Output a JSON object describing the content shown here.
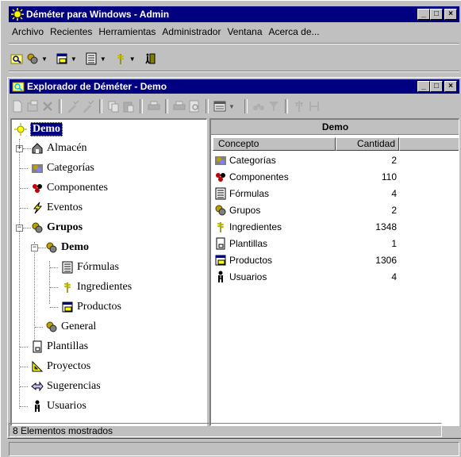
{
  "app": {
    "title": "Déméter para Windows - Admin",
    "menu": [
      "Archivo",
      "Recientes",
      "Herramientas",
      "Administrador",
      "Ventana",
      "Acerca de..."
    ]
  },
  "explorer": {
    "title": "Explorador de Déméter - Demo",
    "tree": {
      "root": "Demo",
      "almacen": "Almacén",
      "categorias": "Categorías",
      "componentes": "Componentes",
      "eventos": "Eventos",
      "grupos": "Grupos",
      "grupos_demo": "Demo",
      "formulas": "Fórmulas",
      "ingredientes": "Ingredientes",
      "productos": "Productos",
      "general": "General",
      "plantillas": "Plantillas",
      "proyectos": "Proyectos",
      "sugerencias": "Sugerencias",
      "usuarios": "Usuarios"
    },
    "list": {
      "header": "Demo",
      "col_concepto": "Concepto",
      "col_cantidad": "Cantidad",
      "rows": [
        {
          "concepto": "Categorías",
          "cantidad": "2"
        },
        {
          "concepto": "Componentes",
          "cantidad": "110"
        },
        {
          "concepto": "Fórmulas",
          "cantidad": "4"
        },
        {
          "concepto": "Grupos",
          "cantidad": "2"
        },
        {
          "concepto": "Ingredientes",
          "cantidad": "1348"
        },
        {
          "concepto": "Plantillas",
          "cantidad": "1"
        },
        {
          "concepto": "Productos",
          "cantidad": "1306"
        },
        {
          "concepto": "Usuarios",
          "cantidad": "4"
        }
      ]
    },
    "status": "8 Elementos mostrados"
  }
}
